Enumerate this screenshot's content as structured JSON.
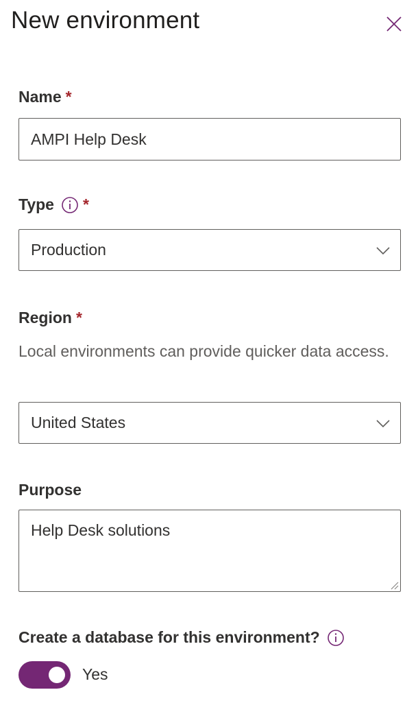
{
  "header": {
    "title": "New environment",
    "close_icon": "close-icon"
  },
  "name_field": {
    "label": "Name",
    "required_marker": "*",
    "value": "AMPI Help Desk"
  },
  "type_field": {
    "label": "Type",
    "required_marker": "*",
    "info_icon": "info-icon",
    "selected": "Production"
  },
  "region_field": {
    "label": "Region",
    "required_marker": "*",
    "description": "Local environments can provide quicker data access.",
    "selected": "United States"
  },
  "purpose_field": {
    "label": "Purpose",
    "value": "Help Desk solutions"
  },
  "database_field": {
    "label": "Create a database for this environment?",
    "info_icon": "info-icon",
    "toggle_on": true,
    "toggle_label": "Yes"
  },
  "colors": {
    "accent": "#742774",
    "required": "#a4262c",
    "border": "#605e5c",
    "text": "#323130"
  }
}
